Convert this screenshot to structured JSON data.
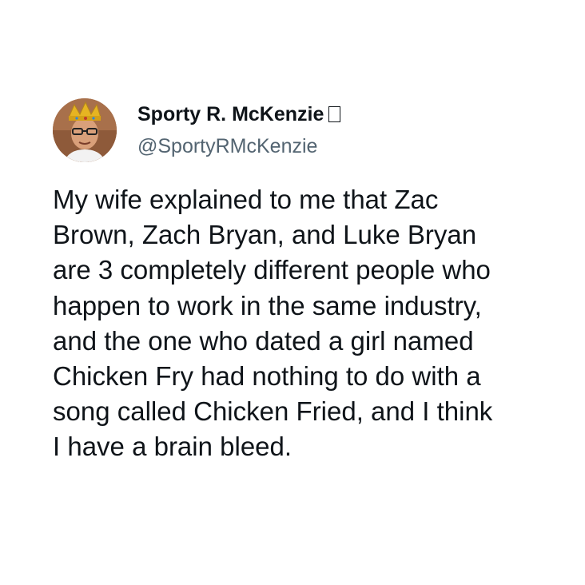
{
  "tweet": {
    "author": {
      "display_name": "Sporty R. McKenzie",
      "name_glyph": "□",
      "handle": "@SportyRMcKenzie",
      "avatar_icon": "avatar-photo-with-crown"
    },
    "text_lines": [
      "My wife explained to me that Zac",
      "Brown, Zach Bryan, and Luke Bryan",
      "are 3 completely different people who",
      "happen to work in the same industry,",
      "and the one who dated a girl named",
      "Chicken Fry had nothing to do with a",
      "song called Chicken Fried, and I think",
      "I have a brain bleed."
    ]
  },
  "colors": {
    "background": "#ffffff",
    "text": "#0f1419",
    "handle": "#536471",
    "crown": "#e6b422"
  }
}
